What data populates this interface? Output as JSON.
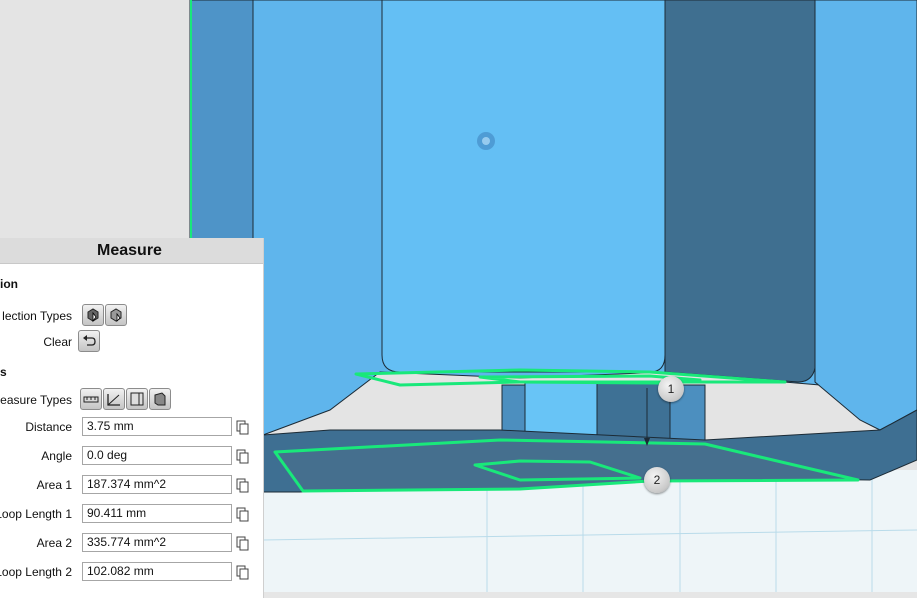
{
  "panel": {
    "title": "Measure",
    "selection_section": "tion",
    "selection_types_label": "lection Types",
    "clear_label": "Clear",
    "results_section": "ts",
    "measure_types_label": "easure Types",
    "fields": [
      {
        "label": "Distance",
        "value": "3.75 mm"
      },
      {
        "label": "Angle",
        "value": "0.0 deg"
      },
      {
        "label": "Area 1",
        "value": "187.374 mm^2"
      },
      {
        "label": "Loop Length 1",
        "value": "90.411 mm"
      },
      {
        "label": "Area 2",
        "value": "335.774 mm^2"
      },
      {
        "label": "Loop Length 2",
        "value": "102.082 mm"
      }
    ]
  },
  "markers": {
    "m1": "1",
    "m2": "2"
  },
  "colors": {
    "model_face": "#62bdf2",
    "model_shadow": "#3d6e8f",
    "highlight": "#19e87a",
    "grid_plane": "#eaf4f8"
  }
}
